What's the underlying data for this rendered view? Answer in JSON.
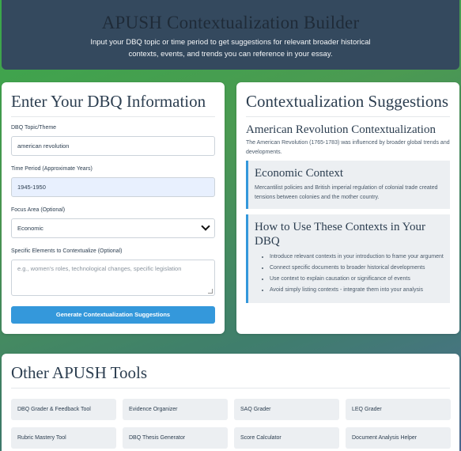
{
  "header": {
    "title": "APUSH Contextualization Builder",
    "subtitle": "Input your DBQ topic or time period to get suggestions for relevant broader historical contexts, events, and trends you can reference in your essay."
  },
  "form": {
    "heading": "Enter Your DBQ Information",
    "topic": {
      "label": "DBQ Topic/Theme",
      "value": "american revolution"
    },
    "period": {
      "label": "Time Period (Approximate Years)",
      "value": "1945-1950"
    },
    "focus": {
      "label": "Focus Area (Optional)",
      "value": "Economic"
    },
    "elements": {
      "label": "Specific Elements to Contextualize (Optional)",
      "placeholder": "e.g., women's roles, technological changes, specific legislation"
    },
    "submit_label": "Generate Contextualization Suggestions"
  },
  "suggestions": {
    "heading": "Contextualization Suggestions",
    "topic_title": "American Revolution Contextualization",
    "intro": "The American Revolution (1765-1783) was influenced by broader global trends and developments.",
    "context": {
      "title": "Economic Context",
      "text": "Mercantilist policies and British imperial regulation of colonial trade created tensions between colonies and the mother country."
    },
    "howto": {
      "title": "How to Use These Contexts in Your DBQ",
      "items": [
        "Introduce relevant contexts in your introduction to frame your argument",
        "Connect specific documents to broader historical developments",
        "Use context to explain causation or significance of events",
        "Avoid simply listing contexts - integrate them into your analysis"
      ]
    }
  },
  "tools": {
    "heading": "Other APUSH Tools",
    "items": [
      "DBQ Grader & Feedback Tool",
      "Evidence Organizer",
      "SAQ Grader",
      "LEQ Grader",
      "Rubric Mastery Tool",
      "DBQ Thesis Generator",
      "Score Calculator",
      "Document Analysis Helper"
    ]
  },
  "colors": {
    "accent": "#3498db",
    "header_bg": "#34495e",
    "text": "#2c3e50"
  }
}
